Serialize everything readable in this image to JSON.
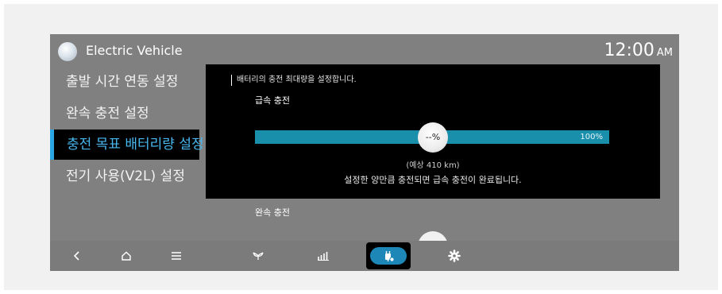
{
  "header": {
    "app_title": "Electric Vehicle",
    "time": "12:00",
    "ampm": "AM"
  },
  "sidebar": {
    "items": [
      {
        "label": "출발 시간 연동 설정",
        "active": false
      },
      {
        "label": "완속 충전 설정",
        "active": false
      },
      {
        "label": "충전 목표 배터리량 설정",
        "active": true
      },
      {
        "label": "전기 사용(V2L) 설정",
        "active": false
      }
    ]
  },
  "panel": {
    "description": "배터리의 충전 최대량을 설정합니다.",
    "fast_charge_label": "급속 충전",
    "slider_value": "--%",
    "slider_fill_fraction": 1.0,
    "slider_max_label": "100%",
    "range_estimate": "(예상 410 km)",
    "note": "설정한 양만큼 충전되면 급속 충전이 완료됩니다."
  },
  "slow_charge": {
    "label": "완속 충전"
  },
  "dock": {
    "icons": [
      "back-icon",
      "home-icon",
      "menu-icon",
      "eco-leaf-icon",
      "energy-bars-icon",
      "ev-charge-icon",
      "settings-gear-icon"
    ],
    "active_icon": "ev-charge-icon"
  },
  "colors": {
    "accent": "#2aa6e4",
    "active_text": "#48b8f0",
    "slider_fill": "#1a8fac",
    "screen_bg": "#808080",
    "panel_bg": "#000000"
  }
}
